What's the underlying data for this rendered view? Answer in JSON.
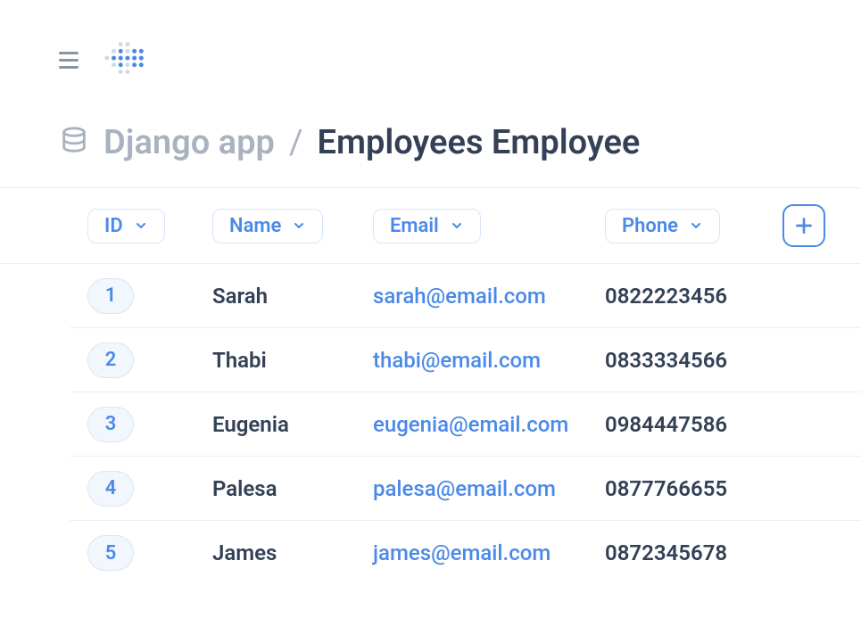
{
  "breadcrumb": {
    "app": "Django app",
    "separator": "/",
    "current": "Employees Employee"
  },
  "columns": {
    "id": "ID",
    "name": "Name",
    "email": "Email",
    "phone": "Phone"
  },
  "rows": [
    {
      "id": "1",
      "name": "Sarah",
      "email": "sarah@email.com",
      "phone": "0822223456"
    },
    {
      "id": "2",
      "name": "Thabi",
      "email": "thabi@email.com",
      "phone": "0833334566"
    },
    {
      "id": "3",
      "name": "Eugenia",
      "email": "eugenia@email.com",
      "phone": "0984447586"
    },
    {
      "id": "4",
      "name": "Palesa",
      "email": "palesa@email.com",
      "phone": "0877766655"
    },
    {
      "id": "5",
      "name": "James",
      "email": "james@email.com",
      "phone": "0872345678"
    }
  ]
}
